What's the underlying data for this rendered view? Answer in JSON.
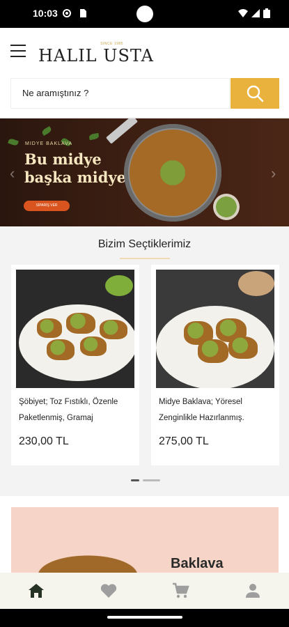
{
  "status_bar": {
    "time": "10:03"
  },
  "header": {
    "logo_text": "HALIL USTA",
    "logo_tagline": "SINCE 1985"
  },
  "search": {
    "placeholder": "Ne aramıştınız ?",
    "value": "Ne aramıştınız ?"
  },
  "banner": {
    "subtitle": "MIDYE BAKLAVA",
    "headline_line1": "Bu midye",
    "headline_line2": "başka midye",
    "cta": "SİPARİŞ VER"
  },
  "picks": {
    "title": "Bizim Seçtiklerimiz",
    "products": [
      {
        "name": "Şöbiyet; Toz Fıstıklı, Özenle Paketlenmiş, Gramaj",
        "price": "230,00 TL"
      },
      {
        "name": "Midye Baklava; Yöresel Zenginlikle Hazırlanmış.",
        "price": "275,00 TL"
      }
    ],
    "active_page": 1,
    "page_count": 2
  },
  "promo": {
    "title": "Baklava"
  },
  "bottom_nav": {
    "items": [
      {
        "icon": "home-icon",
        "active": true
      },
      {
        "icon": "heart-icon",
        "active": false
      },
      {
        "icon": "cart-icon",
        "active": false
      },
      {
        "icon": "account-icon",
        "active": false
      }
    ]
  },
  "colors": {
    "accent": "#e8b23c",
    "nav_active": "#263223",
    "nav_inactive": "#9e9e9e",
    "banner_cta": "#d9541e"
  }
}
